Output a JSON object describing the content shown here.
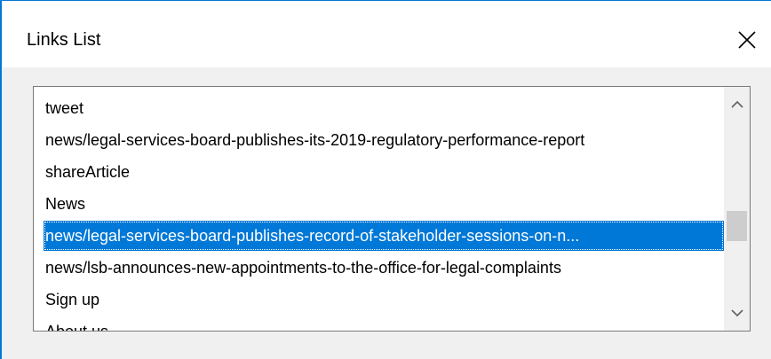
{
  "dialog": {
    "title": "Links List",
    "close_label": "×"
  },
  "list": {
    "items": [
      {
        "label": "tweet",
        "selected": false
      },
      {
        "label": "news/legal-services-board-publishes-its-2019-regulatory-performance-report",
        "selected": false
      },
      {
        "label": "shareArticle",
        "selected": false
      },
      {
        "label": "News",
        "selected": false
      },
      {
        "label": "news/legal-services-board-publishes-record-of-stakeholder-sessions-on-n...",
        "selected": true
      },
      {
        "label": "news/lsb-announces-new-appointments-to-the-office-for-legal-complaints",
        "selected": false
      },
      {
        "label": "Sign up",
        "selected": false
      },
      {
        "label": "About us",
        "selected": false
      }
    ]
  },
  "colors": {
    "selection": "#0078d7",
    "window_border": "#0078d7",
    "background": "#f0f0f0"
  },
  "icons": {
    "close": "close-icon",
    "scroll_up": "chevron-up-icon",
    "scroll_down": "chevron-down-icon"
  }
}
